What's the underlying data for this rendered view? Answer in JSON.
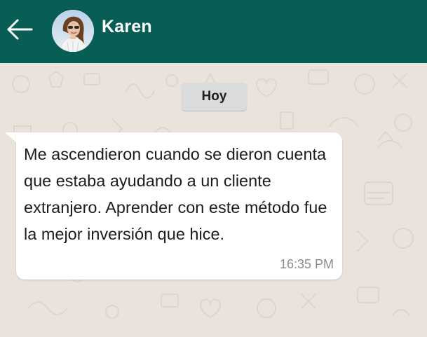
{
  "header": {
    "back_icon": "arrow-left-icon",
    "contact_name": "Karen",
    "background_color": "#085e55"
  },
  "chat": {
    "background_color": "#e9e3dc",
    "date_divider": "Hoy",
    "messages": [
      {
        "direction": "incoming",
        "text": "Me ascendieron cuando se dieron cuenta que estaba ayudando a un cliente extranjero. Aprender con este método fue la mejor inversión que hice.",
        "time": "16:35 PM"
      }
    ]
  }
}
